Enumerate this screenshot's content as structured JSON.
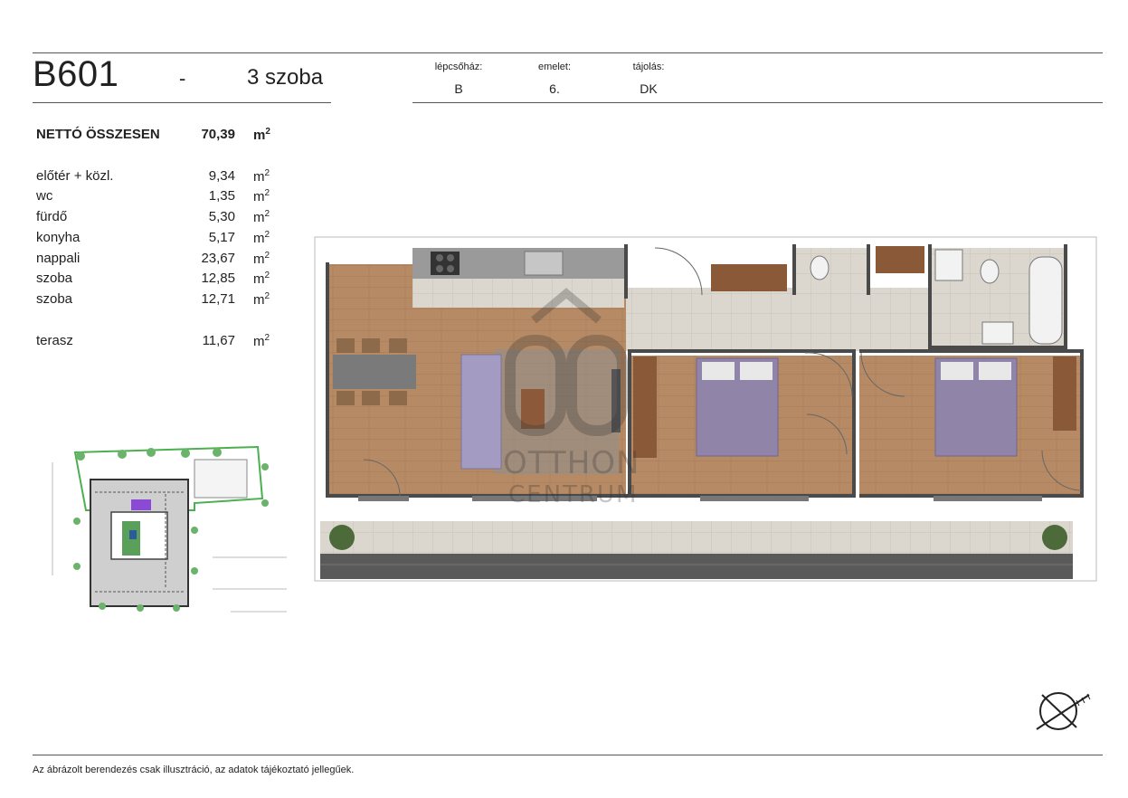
{
  "header": {
    "unit_code": "B601",
    "dash": "-",
    "rooms": "3 szoba",
    "meta": [
      {
        "label": "lépcsőház:",
        "value": "B"
      },
      {
        "label": "emelet:",
        "value": "6."
      },
      {
        "label": "tájolás:",
        "value": "DK"
      }
    ]
  },
  "areas": {
    "total": {
      "name": "NETTÓ ÖSSZESEN",
      "value": "70,39",
      "unit": "m",
      "sup": "2"
    },
    "rooms": [
      {
        "name": "előtér + közl.",
        "value": "9,34",
        "unit": "m",
        "sup": "2"
      },
      {
        "name": "wc",
        "value": "1,35",
        "unit": "m",
        "sup": "2"
      },
      {
        "name": "fürdő",
        "value": "5,30",
        "unit": "m",
        "sup": "2"
      },
      {
        "name": "konyha",
        "value": "5,17",
        "unit": "m",
        "sup": "2"
      },
      {
        "name": "nappali",
        "value": "23,67",
        "unit": "m",
        "sup": "2"
      },
      {
        "name": "szoba",
        "value": "12,85",
        "unit": "m",
        "sup": "2"
      },
      {
        "name": "szoba",
        "value": "12,71",
        "unit": "m",
        "sup": "2"
      }
    ],
    "terrace": {
      "name": "terasz",
      "value": "11,67",
      "unit": "m",
      "sup": "2"
    }
  },
  "watermark": {
    "line1": "OTTHON",
    "line2": "CENTRUM"
  },
  "footer": {
    "note": "Az ábrázolt berendezés csak illusztráció, az adatok tájékoztató jellegűek."
  },
  "colors": {
    "wood": "#b68a64",
    "tile": "#d9d4cb",
    "wall": "#4a4a4a",
    "bed": "#9085a8",
    "sofa": "#a49bc2",
    "hedge": "#6ab36a"
  }
}
